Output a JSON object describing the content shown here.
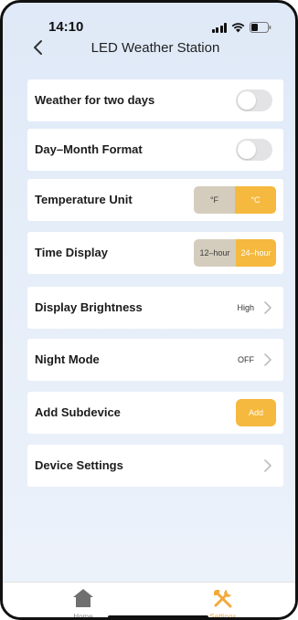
{
  "status_bar": {
    "time": "14:10"
  },
  "nav": {
    "title": "LED Weather Station"
  },
  "settings": {
    "weather_two_days": {
      "label": "Weather for two days",
      "enabled": false
    },
    "day_month_format": {
      "label": "Day–Month Format",
      "enabled": false
    },
    "temperature_unit": {
      "label": "Temperature Unit",
      "options": [
        "°F",
        "°C"
      ],
      "selected": "°C"
    },
    "time_display": {
      "label": "Time Display",
      "options": [
        "12–hour",
        "24–hour"
      ],
      "selected": "24–hour"
    },
    "display_brightness": {
      "label": "Display Brightness",
      "value": "High"
    },
    "night_mode": {
      "label": "Night Mode",
      "value": "OFF"
    },
    "add_subdevice": {
      "label": "Add Subdevice",
      "button": "Add"
    },
    "device_settings": {
      "label": "Device Settings"
    }
  },
  "tabs": [
    {
      "label": "Home",
      "icon": "home-icon",
      "active": false
    },
    {
      "label": "Settings",
      "icon": "tools-icon",
      "active": true
    }
  ],
  "colors": {
    "accent": "#f5b93f",
    "segment_inactive": "#d4cdbd",
    "toggle_off": "#e3e3e5",
    "background_top": "#dfe9f7"
  }
}
